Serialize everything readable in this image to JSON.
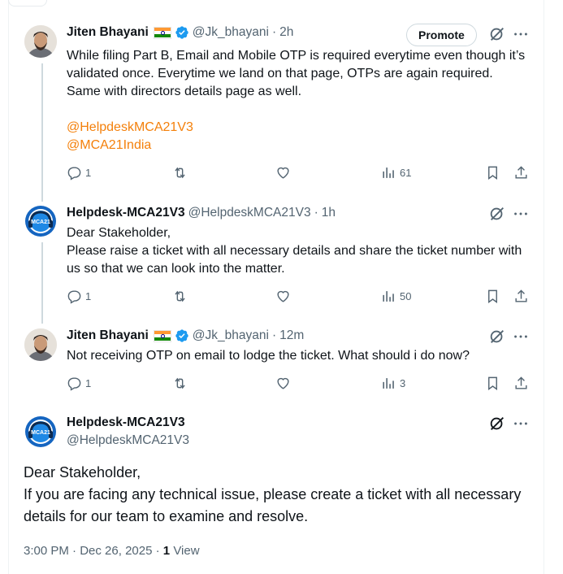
{
  "colors": {
    "link": "#f4800b",
    "verified": "#1d9bf0",
    "muted": "#536471",
    "text": "#0f1419"
  },
  "tweets": [
    {
      "name": "Jiten Bhayani",
      "handle": "@Jk_bhayani",
      "sep": "·",
      "time": "2h",
      "promote_label": "Promote",
      "body": [
        "While filing Part B, Email and Mobile OTP is required everytime even though it’s validated once.  Everytime we land on that page, OTPs are again required. Same with directors details page as well."
      ],
      "mentions": [
        "@HelpdeskMCA21V3",
        "@MCA21India"
      ],
      "replies": "1",
      "views": "61"
    },
    {
      "name": "Helpdesk-MCA21V3",
      "handle": "@HelpdeskMCA21V3",
      "sep": "·",
      "time": "1h",
      "body": [
        "Dear Stakeholder,",
        "Please raise a ticket with all necessary details and share the ticket number with us so that we can look into the matter."
      ],
      "replies": "1",
      "views": "50"
    },
    {
      "name": "Jiten Bhayani",
      "handle": "@Jk_bhayani",
      "sep": "·",
      "time": "12m",
      "body": [
        "Not receiving OTP on email to lodge the ticket. What should i do now?"
      ],
      "replies": "1",
      "views": "3"
    }
  ],
  "main_tweet": {
    "name": "Helpdesk-MCA21V3",
    "handle": "@HelpdeskMCA21V3",
    "avatar_text": "MCA21",
    "body": [
      "Dear Stakeholder,",
      "If you are facing any technical issue, please create a ticket with all necessary details for our team to examine and resolve."
    ],
    "time": "3:00 PM",
    "sep": "·",
    "date": "Dec 26, 2025",
    "sep2": "·",
    "views_count": "1",
    "views_label": "View"
  }
}
